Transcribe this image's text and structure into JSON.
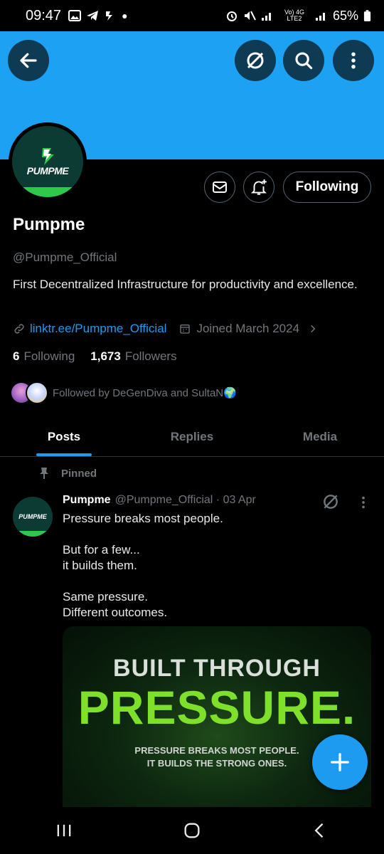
{
  "statusbar": {
    "time": "09:47",
    "right_text": "Vo) 4G LTE2",
    "battery": "65%"
  },
  "colors": {
    "accent": "#1d9bf0",
    "banner": "#1da1f2",
    "brand_green": "#2ec94a"
  },
  "header": {
    "back_icon": "arrow-left-icon",
    "grok_icon": "grok-icon",
    "search_icon": "search-icon",
    "more_icon": "more-vertical-icon"
  },
  "profile": {
    "avatar_text": "PUMPME",
    "name": "Pumpme",
    "handle": "@Pumpme_Official",
    "bio": "First Decentralized Infrastructure for  productivity and excellence.",
    "link": "linktr.ee/Pumpme_Official",
    "joined": "Joined March 2024",
    "following_count": "6",
    "following_label": "Following",
    "followers_count": "1,673",
    "followers_label": "Followers",
    "followed_by": "Followed by DeGenDiva and SultaN🌍",
    "follow_button": "Following"
  },
  "tabs": [
    {
      "label": "Posts",
      "active": true
    },
    {
      "label": "Replies",
      "active": false
    },
    {
      "label": "Media",
      "active": false
    }
  ],
  "post": {
    "pinned_label": "Pinned",
    "author_name": "Pumpme",
    "author_handle": "@Pumpme_Official · 03 Apr",
    "text": "Pressure breaks most people.\n\nBut for a few...\nit builds them.\n\nSame pressure.\nDifferent outcomes.",
    "avatar_text": "PUMPME",
    "media": {
      "line1": "BUILT THROUGH",
      "line2": "PRESSURE.",
      "line3": "PRESSURE BREAKS MOST PEOPLE.",
      "line4": "IT BUILDS THE STRONG ONES."
    }
  }
}
